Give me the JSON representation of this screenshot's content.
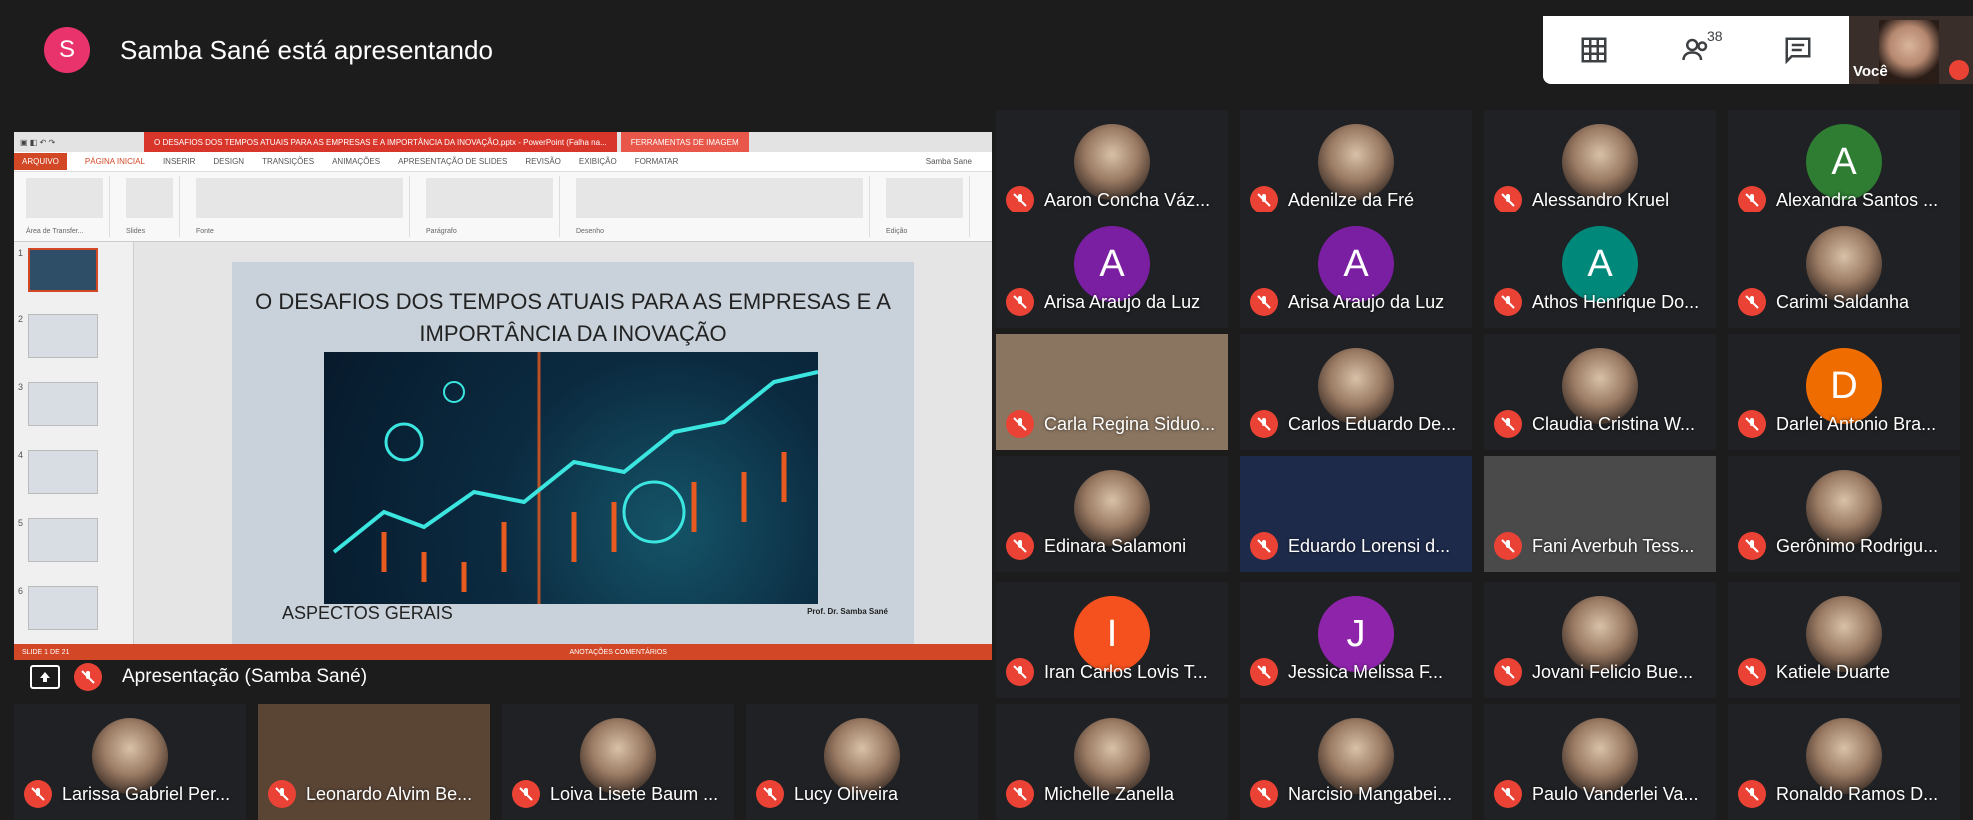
{
  "presenter": {
    "initial": "S",
    "text": "Samba Sané está apresentando"
  },
  "controls": {
    "participant_count": "38",
    "self_label": "Você"
  },
  "presentation": {
    "label": "Apresentação (Samba Sané)",
    "ppt_title": "O DESAFIOS DOS TEMPOS ATUAIS PARA AS EMPRESAS E A IMPORTÂNCIA DA INOVAÇÃO.pptx - PowerPoint (Falha na...",
    "ppt_tools_label": "FERRAMENTAS DE IMAGEM",
    "tabs": [
      "ARQUIVO",
      "PÁGINA INICIAL",
      "INSERIR",
      "DESIGN",
      "TRANSIÇÕES",
      "ANIMAÇÕES",
      "APRESENTAÇÃO DE SLIDES",
      "REVISÃO",
      "EXIBIÇÃO",
      "FORMATAR"
    ],
    "user": "Samba Sane",
    "ribbon_groups": [
      "Área de Transfer...",
      "Slides",
      "Fonte",
      "Parágrafo",
      "Desenho",
      "Edição"
    ],
    "slide_title": "O DESAFIOS DOS TEMPOS ATUAIS PARA AS EMPRESAS E A IMPORTÂNCIA DA INOVAÇÃO",
    "slide_footer": "ASPECTOS GERAIS",
    "slide_author": "Prof. Dr. Samba Sané",
    "status": "SLIDE 1 DE 21",
    "status_right": "ANOTAÇÕES   COMENTÁRIOS"
  },
  "participants": [
    {
      "name": "Aaron Concha Váz...",
      "type": "photo"
    },
    {
      "name": "Adenilze da Fré",
      "type": "photo"
    },
    {
      "name": "Alessandro Kruel",
      "type": "photo"
    },
    {
      "name": "Alexandra Santos ...",
      "type": "initial",
      "initial": "A",
      "color": "#2e7d32"
    },
    {
      "name": "Arisa Araujo da Luz",
      "type": "initial",
      "initial": "A",
      "color": "#7b1fa2"
    },
    {
      "name": "Arisa Araujo da Luz",
      "type": "initial",
      "initial": "A",
      "color": "#7b1fa2"
    },
    {
      "name": "Athos Henrique Do...",
      "type": "initial",
      "initial": "A",
      "color": "#00897b"
    },
    {
      "name": "Carimi Saldanha",
      "type": "photo"
    },
    {
      "name": "Carla Regina Siduo...",
      "type": "video",
      "color": "#8a7560"
    },
    {
      "name": "Carlos Eduardo De...",
      "type": "photo"
    },
    {
      "name": "Claudia Cristina W...",
      "type": "photo"
    },
    {
      "name": "Darlei Antonio Bra...",
      "type": "initial",
      "initial": "D",
      "color": "#ef6c00"
    },
    {
      "name": "Edinara Salamoni",
      "type": "photo"
    },
    {
      "name": "Eduardo Lorensi d...",
      "type": "video",
      "color": "#1e2a4a"
    },
    {
      "name": "Fani Averbuh Tess...",
      "type": "video",
      "color": "#4a4a4a"
    },
    {
      "name": "Gerônimo Rodrigu...",
      "type": "photo"
    },
    {
      "name": "Iran Carlos Lovis T...",
      "type": "initial",
      "initial": "I",
      "color": "#f4511e"
    },
    {
      "name": "Jessica Melissa F...",
      "type": "initial",
      "initial": "J",
      "color": "#8e24aa"
    },
    {
      "name": "Jovani Felicio Bue...",
      "type": "photo"
    },
    {
      "name": "Katiele Duarte",
      "type": "photo"
    },
    {
      "name": "Michelle Zanella",
      "type": "photo"
    },
    {
      "name": "Narcisio Mangabei...",
      "type": "photo"
    },
    {
      "name": "Paulo Vanderlei Va...",
      "type": "photo"
    },
    {
      "name": "Ronaldo Ramos D...",
      "type": "photo"
    }
  ],
  "bottom_participants": [
    {
      "name": "Larissa Gabriel Per...",
      "type": "photo"
    },
    {
      "name": "Leonardo Alvim Be...",
      "type": "video",
      "color": "#5a4535"
    },
    {
      "name": "Loiva Lisete Baum ...",
      "type": "photo"
    },
    {
      "name": "Lucy Oliveira",
      "type": "photo"
    }
  ]
}
